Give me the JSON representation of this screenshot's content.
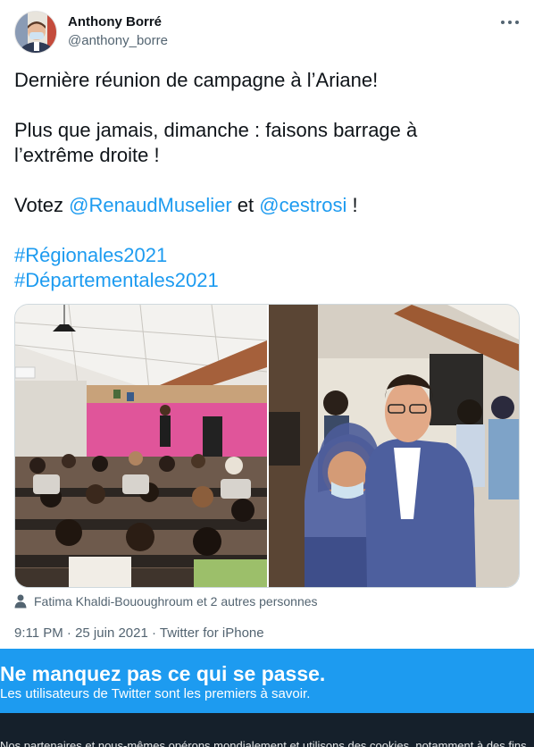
{
  "author": {
    "name": "Anthony Borré",
    "handle": "@anthony_borre"
  },
  "tweet": {
    "line1": "Dernière réunion de campagne à l’Ariane!",
    "line2": "Plus que jamais, dimanche : faisons barrage à",
    "line3": "l’extrême droite !",
    "votez_prefix": "Votez ",
    "mention1": "@RenaudMuselier",
    "votez_mid": " et ",
    "mention2": "@cestrosi",
    "votez_suffix": " !",
    "hashtag1": "#Régionales2021",
    "hashtag2": "#Départementales2021"
  },
  "tagged": "Fatima Khaldi-Bououghroum et 2 autres personnes",
  "meta": "9:11 PM · 25 juin 2021 · Twitter for iPhone",
  "banner": {
    "title": "Ne manquez pas ce qui se passe.",
    "subtitle": "Les utilisateurs de Twitter sont les premiers à savoir."
  },
  "cookie_notice": "Nos partenaires et nous-mêmes opérons mondialement et utilisons des cookies, notamment à des fins",
  "icons": {
    "more": "more-horizontal-icon",
    "tag": "person-icon"
  },
  "colors": {
    "link": "#1d9bf0",
    "banner": "#1d9bf0",
    "cookie_bar": "#15202b",
    "secondary_text": "#536471"
  }
}
